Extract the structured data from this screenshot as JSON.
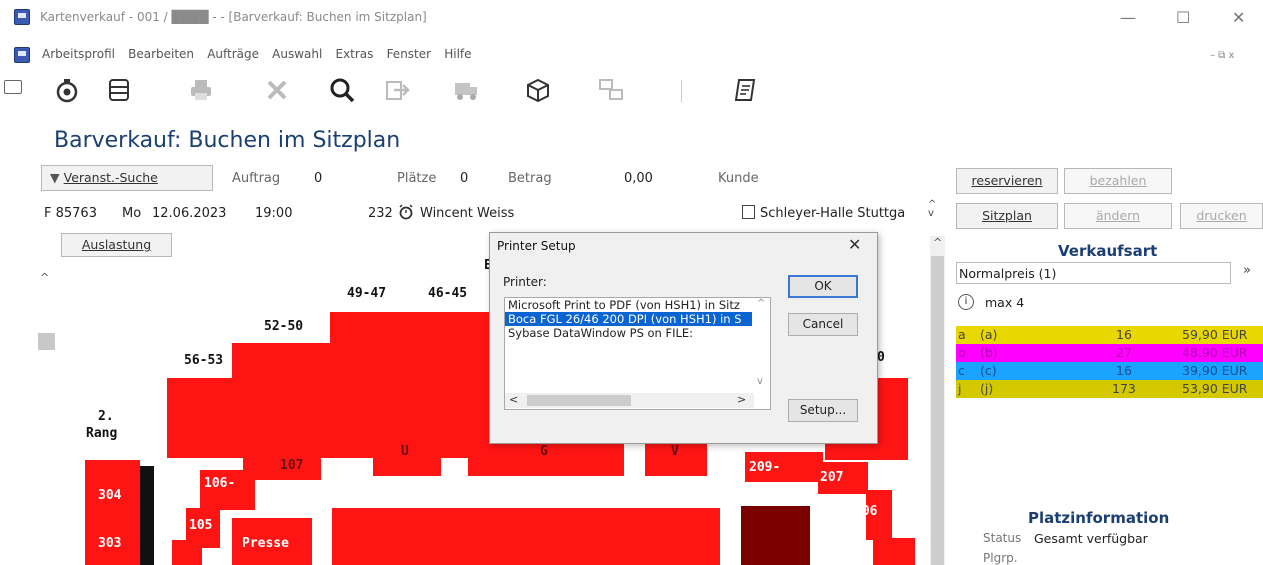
{
  "window": {
    "title": "Kartenverkauf  - 001 /  ████ -  - [Barverkauf: Buchen im Sitzplan]",
    "controls": {
      "minimize": "—",
      "maximize": "☐",
      "close": "✕"
    },
    "inner_controls": "–  ⧉  x"
  },
  "menu": [
    "Arbeitsprofil",
    "Bearbeiten",
    "Aufträge",
    "Auswahl",
    "Extras",
    "Fenster",
    "Hilfe"
  ],
  "toolbar_icons": [
    "stopwatch-icon",
    "list-icon",
    "printer-icon",
    "delete-icon",
    "search-icon",
    "export-icon",
    "truck-icon",
    "box-icon",
    "network-icon",
    "document-icon"
  ],
  "page": {
    "title": "Barverkauf: Buchen im Sitzplan",
    "search_button": "Veranst.-Suche",
    "auftrag_label": "Auftrag",
    "auftrag_value": "0",
    "plaetze_label": "Plätze",
    "plaetze_value": "0",
    "betrag_label": "Betrag",
    "betrag_value": "0,00",
    "kunde_label": "Kunde",
    "event_code": "F 85763",
    "event_day": "Mo",
    "event_date": "12.06.2023",
    "event_time": "19:00",
    "event_number": "232",
    "event_name": "Wincent Weiss",
    "venue": "Schleyer-Halle Stuttga",
    "auslastung_button": "Auslastung"
  },
  "actions": {
    "reservieren": "reservieren",
    "bezahlen": "bezahlen",
    "sitzplan": "Sitzplan",
    "aendern": "ändern",
    "drucken": "drucken"
  },
  "seatmap": {
    "labels": {
      "l1": "49-47",
      "l2": "46-45",
      "l3": "52-50",
      "l4": "56-53",
      "l5": "2.",
      "l6": "Rang",
      "l7": "E",
      "l8": "0"
    },
    "sections": {
      "s107": "107",
      "s106": "106-",
      "s105": "105",
      "s304": "304",
      "s303": "303",
      "presse": "Presse",
      "u": "U",
      "g": "G",
      "v": "V",
      "s209": "209-",
      "s207": "207",
      "s206": "206"
    }
  },
  "dialog": {
    "title": "Printer Setup",
    "printer_label": "Printer:",
    "printers": [
      "Microsoft Print to PDF (von HSH1) in Sitz",
      "Boca FGL 26/46 200 DPI (von HSH1) in S",
      "Sybase DataWindow PS on FILE:"
    ],
    "selected_index": 1,
    "ok": "OK",
    "cancel": "Cancel",
    "setup": "Setup..."
  },
  "panel": {
    "verkaufsart_title": "Verkaufsart",
    "verkaufsart_value": "Normalpreis (1)",
    "max_text": "max 4",
    "price_rows": [
      {
        "code": "a",
        "name": "(a)",
        "count": "16",
        "price": "59,90 EUR",
        "bg": "#e8d800",
        "fg": "#444"
      },
      {
        "code": "b",
        "name": "(b)",
        "count": "27",
        "price": "48,90 EUR",
        "bg": "#ff00ff",
        "fg": "#b000b0"
      },
      {
        "code": "c",
        "name": "(c)",
        "count": "16",
        "price": "39,90 EUR",
        "bg": "#1aa3ff",
        "fg": "#1d4d8a"
      },
      {
        "code": "j",
        "name": "(j)",
        "count": "173",
        "price": "53,90 EUR",
        "bg": "#d4c800",
        "fg": "#444"
      }
    ],
    "platzinfo_title": "Platzinformation",
    "status_label": "Status",
    "status_value": "Gesamt verfügbar",
    "plgrp_label": "Plgrp."
  },
  "colors": {
    "seat_red": "#ff1414",
    "sold_dark": "#7a0000",
    "title_blue": "#1c3f73",
    "selection": "#0a64d2"
  }
}
